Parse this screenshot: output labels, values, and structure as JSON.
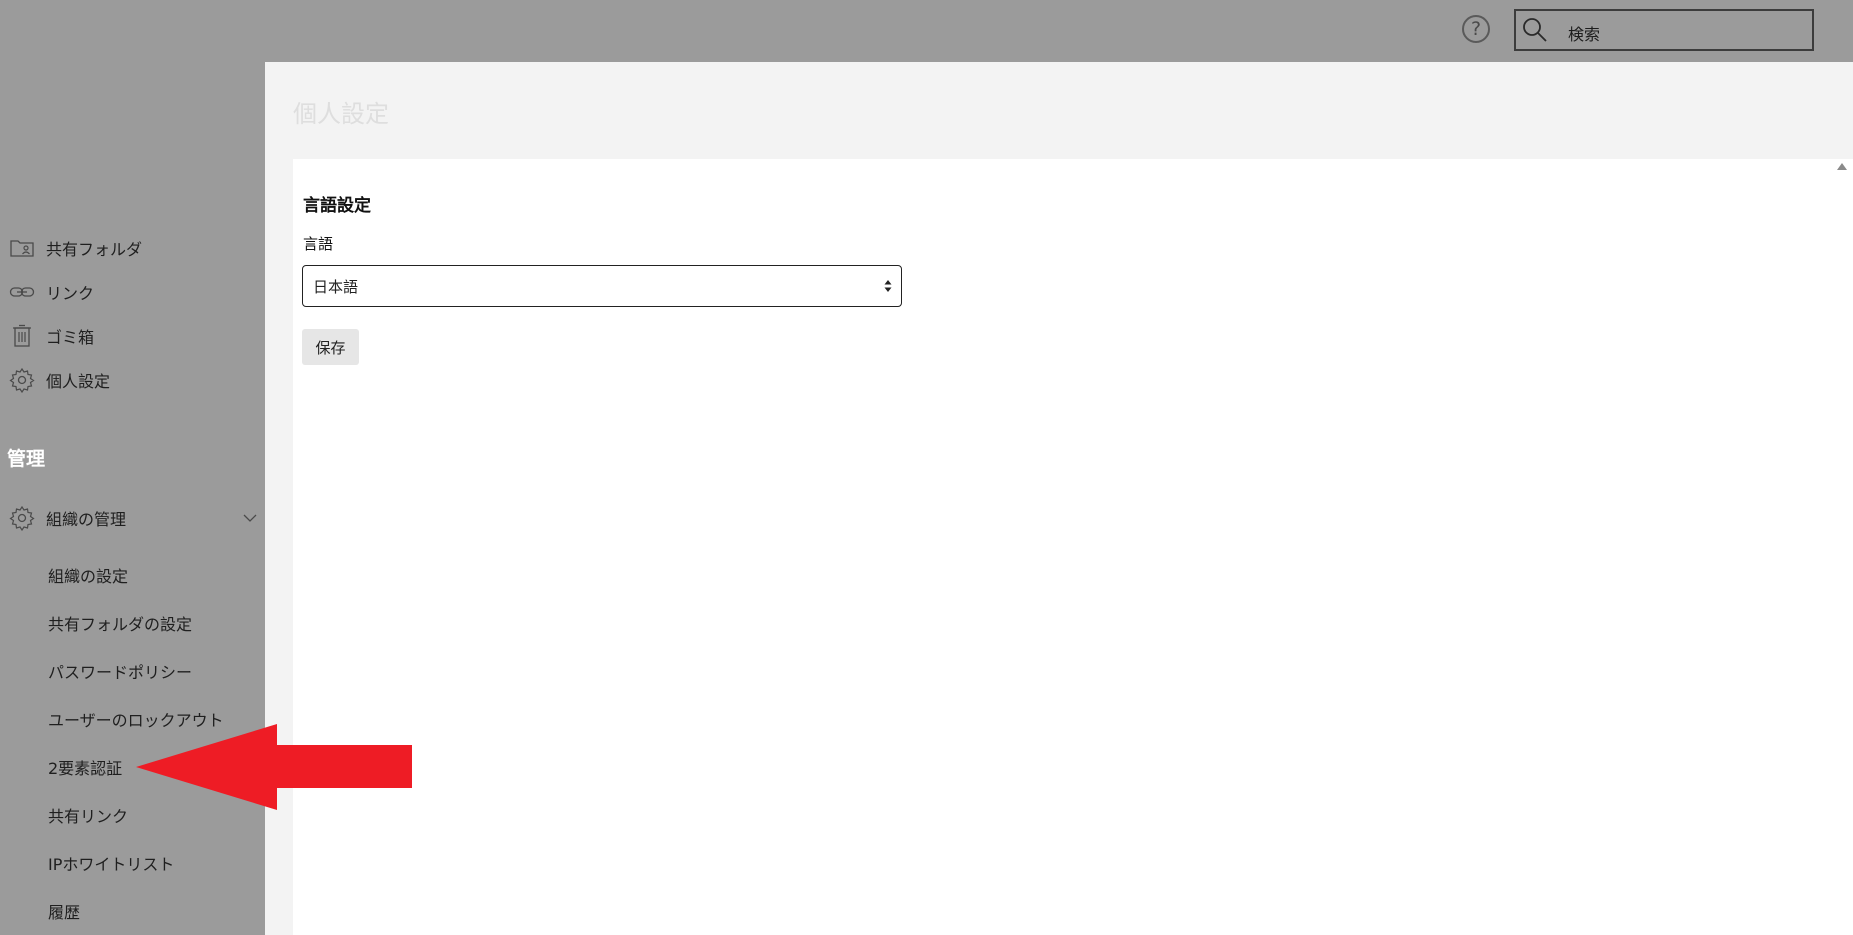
{
  "header": {
    "help_symbol": "?",
    "search_placeholder": "検索"
  },
  "sidebar": {
    "items": [
      {
        "label": "共有フォルダ",
        "icon": "shared-folder-icon"
      },
      {
        "label": "リンク",
        "icon": "link-icon"
      },
      {
        "label": "ゴミ箱",
        "icon": "trash-icon"
      },
      {
        "label": "個人設定",
        "icon": "gear-icon"
      }
    ],
    "admin_section_title": "管理",
    "org_group": {
      "label": "組織の管理",
      "icon": "gear-icon",
      "expanded": true,
      "sub_items": [
        "組織の設定",
        "共有フォルダの設定",
        "パスワードポリシー",
        "ユーザーのロックアウト",
        "2要素認証",
        "共有リンク",
        "IPホワイトリスト",
        "履歴"
      ]
    }
  },
  "main": {
    "page_title": "個人設定",
    "section_heading": "言語設定",
    "field_label": "言語",
    "language_selected": "日本語",
    "save_label": "保存"
  },
  "colors": {
    "sidebar_bg": "#9b9b9b",
    "main_bg": "#f3f3f3",
    "panel_bg": "#ffffff",
    "annotation_red": "#ee1c25"
  }
}
